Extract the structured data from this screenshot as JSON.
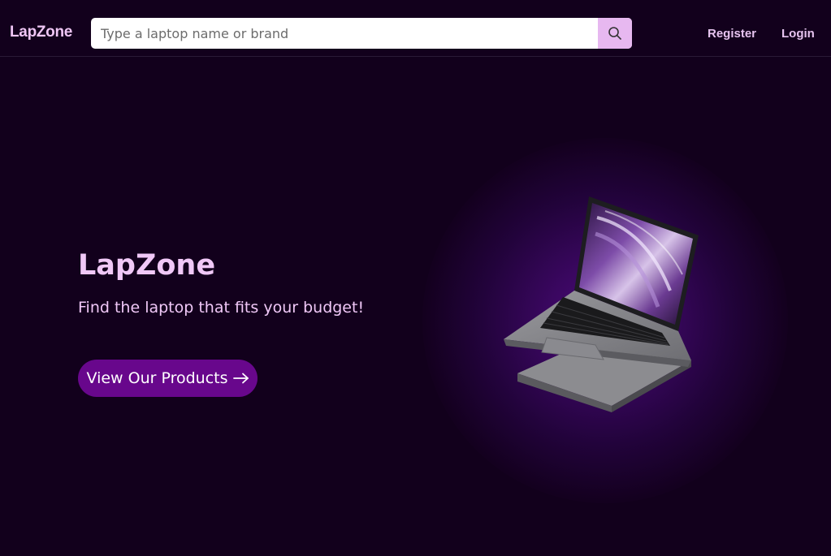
{
  "header": {
    "brand": "LapZone",
    "search": {
      "placeholder": "Type a laptop name or brand",
      "value": "",
      "icon": "search-icon"
    },
    "nav": {
      "register": "Register",
      "login": "Login"
    }
  },
  "hero": {
    "title": "LapZone",
    "subtitle": "Find the laptop that fits your budget!",
    "cta_label": "View Our Products",
    "cta_icon": "arrow-right-icon",
    "image_icon": "laptop-image"
  },
  "colors": {
    "background": "#12001c",
    "brand_text": "#efc6f5",
    "button": "#68078c",
    "search_button": "#e7b8f0"
  }
}
